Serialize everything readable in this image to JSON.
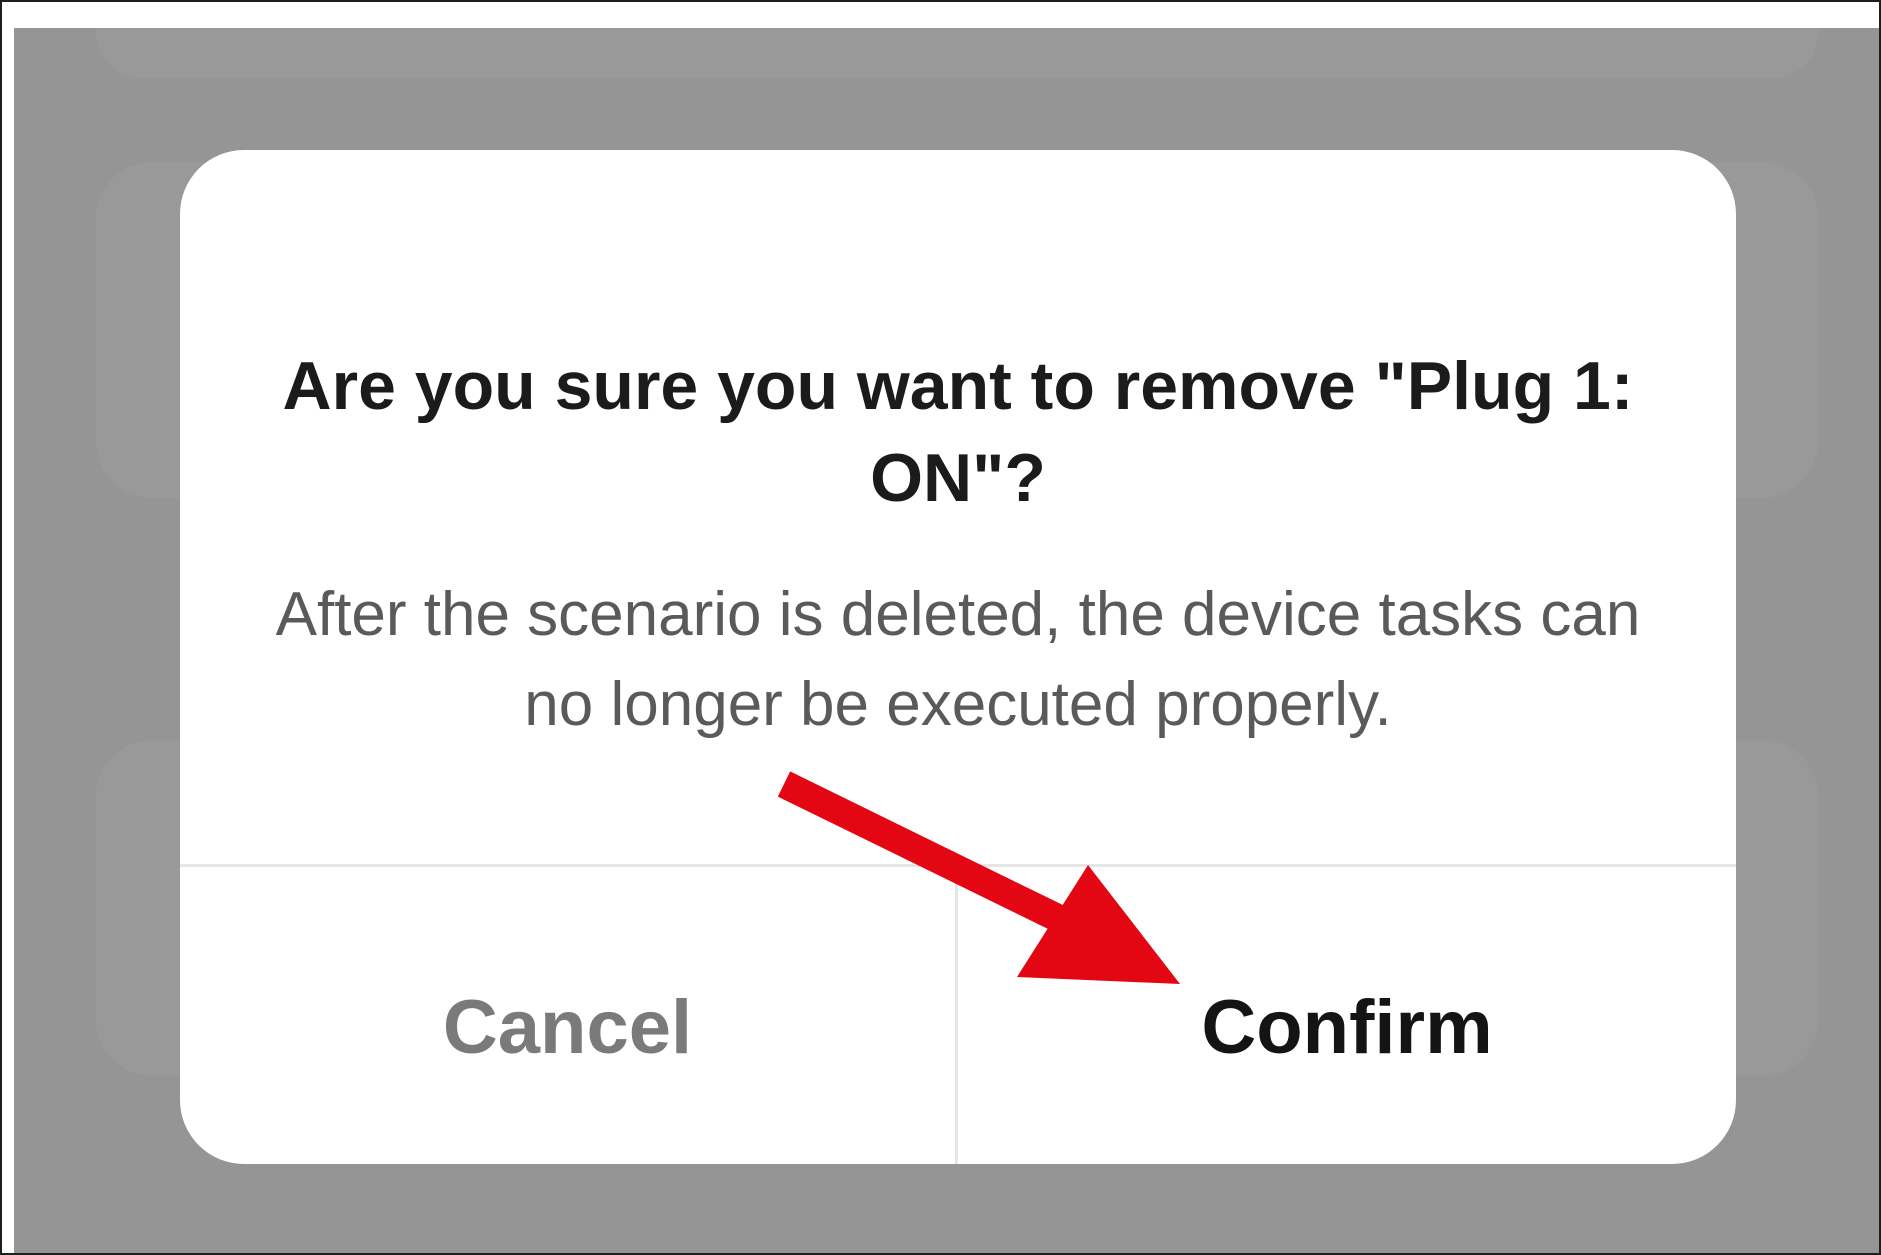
{
  "dialog": {
    "title": "Are you sure you want to remove \"Plug 1: ON\"?",
    "message": "After the scenario is deleted, the device tasks can no longer be executed properly.",
    "cancel_label": "Cancel",
    "confirm_label": "Confirm"
  },
  "colors": {
    "overlay": "#959595",
    "dialog_background": "#ffffff",
    "title_text": "#1b1b1b",
    "message_text": "#5a5a5a",
    "cancel_text": "#7a7a7a",
    "confirm_text": "#141414",
    "annotation_arrow": "#e30613"
  },
  "icons": {
    "annotation": "red-arrow-icon"
  }
}
